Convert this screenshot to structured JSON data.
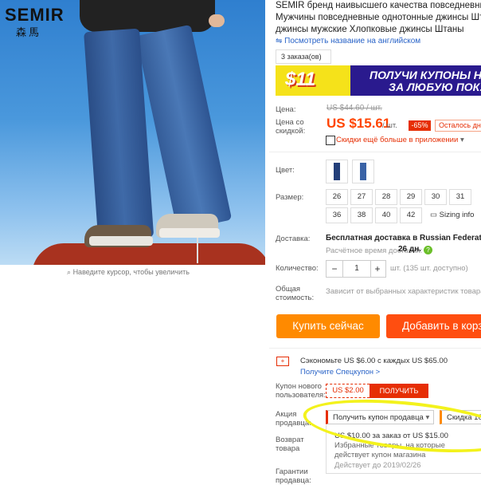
{
  "gallery": {
    "brand_logo": "SEMIR",
    "brand_logo_cn": "森馬",
    "zoom_hint": "Наведите курсор, чтобы увеличить"
  },
  "product": {
    "title_lines": [
      "SEMIR бренд наивысшего качества повседневные",
      "Мужчины повседневные однотонные джинсы Шт",
      "джинсы мужские Хлопковые джинсы Штаны"
    ],
    "translate_link": "Посмотреть название на английском",
    "orders": "3 заказа(ов)"
  },
  "banner": {
    "price": "$11",
    "line1": "ПОЛУЧИ КУПОНЫ НА",
    "line2": "ЗА ЛЮБУЮ ПОКУП"
  },
  "price": {
    "label": "Цена:",
    "old": "US $44.60 / шт.",
    "discount_label": "Цена со скидкой:",
    "new": "US $15.61",
    "per_unit": "/ шт.",
    "discount_badge": "-65%",
    "remaining": "Осталось дн",
    "app_discount": "Скидки ещё больше в приложении"
  },
  "options": {
    "color_label": "Цвет:",
    "size_label": "Размер:",
    "sizes_row1": [
      "26",
      "27",
      "28",
      "29",
      "30",
      "31"
    ],
    "sizes_row2": [
      "36",
      "38",
      "40",
      "42"
    ],
    "sizing_info": "Sizing info"
  },
  "shipping": {
    "label": "Доставка:",
    "text": "Бесплатная доставка в Russian Federation с",
    "estimate_label": "Расчётное время доставки:",
    "estimate_days": "26 дн."
  },
  "quantity": {
    "label": "Количество:",
    "minus": "−",
    "value": "1",
    "plus": "+",
    "available": "шт. (135 шт. доступно)"
  },
  "total": {
    "label": "Общая стоимость:",
    "text": "Зависит от выбранных характеристик товара"
  },
  "actions": {
    "buy_now": "Купить сейчас",
    "add_to_cart": "Добавить в корз"
  },
  "coupons": {
    "save_icon": "+",
    "save_text": "Сэкономьте US $6.00 с каждых US $65.00",
    "save_link": "Получите Спецкупон >",
    "new_user_label": "Купон нового пользователя:",
    "new_user_value": "US $2.00",
    "new_user_get": "ПОЛУЧИТЬ",
    "seller_label": "Акция продавца:",
    "seller_dropdown": "Получить купон продавца",
    "seller_discount": "Скидка 10",
    "seller_coupon_1": "US $10.00 за заказ от US $15.00",
    "seller_coupon_2": "Избранные товары, на которые",
    "seller_coupon_3": "действует купон магазина",
    "seller_coupon_4": "Действует до 2019/02/26",
    "return_label": "Возврат товара",
    "guarantee_label": "Гарантии продавца:"
  },
  "colors": {
    "price_red": "#ff4400",
    "buy_orange": "#ff8a00",
    "cart_red": "#ff4e10",
    "highlight_yellow": "#f3f21c",
    "link_blue": "#2a64c8"
  }
}
